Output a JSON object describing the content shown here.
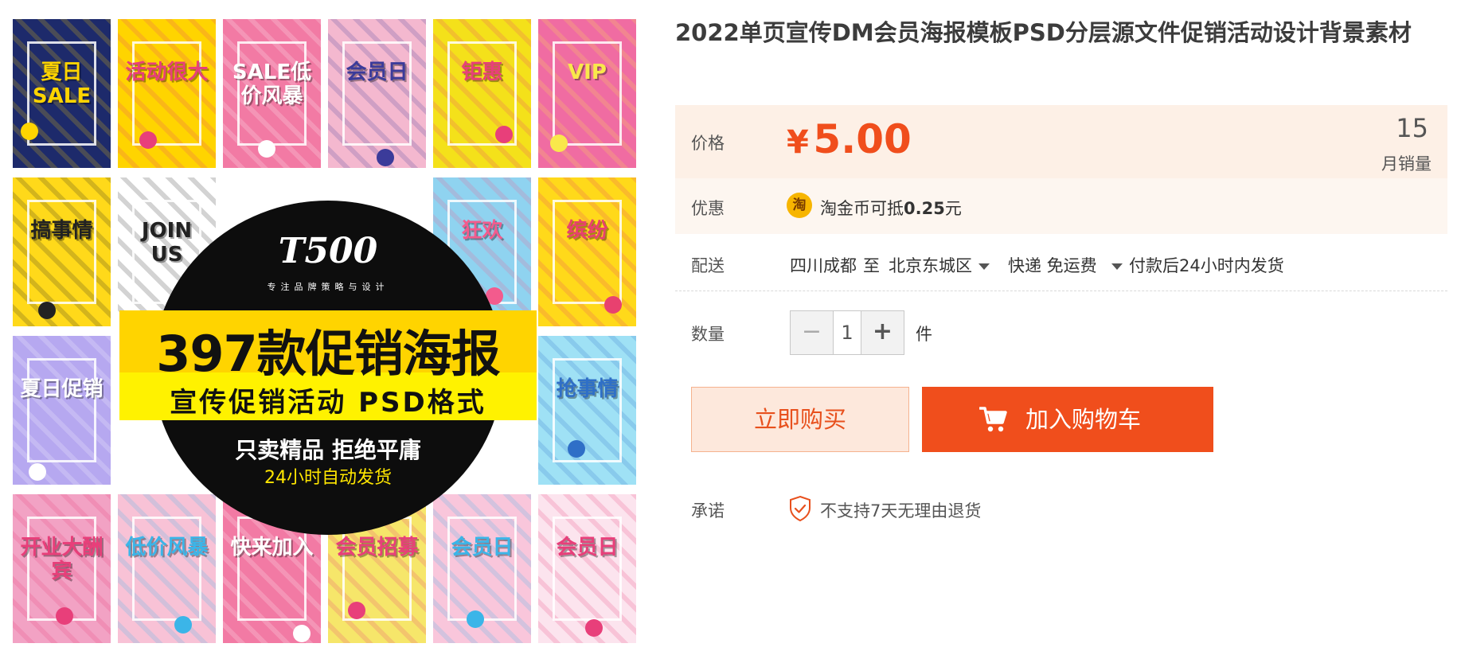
{
  "product": {
    "title": "2022单页宣传DM会员海报模板PSD分层源文件促销活动设计背景素材",
    "image": {
      "logo": "T500",
      "tagline": "专注品牌策略与设计",
      "headline": "397款促销海报",
      "subheadline": "宣传促销活动 PSD格式",
      "line1": "只卖精品 拒绝平庸",
      "line2": "24小时自动发货",
      "thumbnails": [
        {
          "text": "夏日SALE",
          "bg": "#1d2a6b",
          "accent": "#ffd400"
        },
        {
          "text": "活动很大",
          "bg": "#ffd400",
          "accent": "#e83f7a"
        },
        {
          "text": "SALE低价风暴",
          "bg": "#f27aa4",
          "accent": "#ffffff"
        },
        {
          "text": "会员日",
          "bg": "#f4b8cf",
          "accent": "#3b3b9a"
        },
        {
          "text": "钜惠",
          "bg": "#f4e11a",
          "accent": "#e83f7a"
        },
        {
          "text": "VIP",
          "bg": "#f06ca2",
          "accent": "#f9e84b"
        },
        {
          "text": "搞事情",
          "bg": "#ffd91a",
          "accent": "#222222"
        },
        {
          "text": "JOIN US",
          "bg": "#ffffff",
          "accent": "#222222"
        },
        {
          "text": "狂欢",
          "bg": "#8fd3f0",
          "accent": "#f35b8d"
        },
        {
          "text": "缤纷",
          "bg": "#ffd91a",
          "accent": "#e8416f"
        },
        {
          "text": "夏日促销",
          "bg": "#b6a8f0",
          "accent": "#ffffff"
        },
        {
          "text": "抢事情",
          "bg": "#9fe1f5",
          "accent": "#2f6fc7"
        },
        {
          "text": "开业大酬宾",
          "bg": "#f2a2c4",
          "accent": "#e83f7a"
        },
        {
          "text": "低价风暴",
          "bg": "#f8c2d6",
          "accent": "#3bb5e8"
        },
        {
          "text": "快来加入",
          "bg": "#f27aa4",
          "accent": "#ffffff"
        },
        {
          "text": "会员招募",
          "bg": "#f6e66a",
          "accent": "#e83f7a"
        },
        {
          "text": "会员日",
          "bg": "#f9c6db",
          "accent": "#3bb5e8"
        },
        {
          "text": "会员日",
          "bg": "#fce4ee",
          "accent": "#e83f7a"
        }
      ]
    }
  },
  "price": {
    "label": "价格",
    "currency": "¥",
    "amount": "5.00",
    "sales_count": "15",
    "sales_label": "月销量"
  },
  "promo": {
    "label": "优惠",
    "coin_icon": "淘",
    "text": "淘金币可抵",
    "amount": "0.25",
    "unit": "元"
  },
  "shipping": {
    "label": "配送",
    "from": "四川成都",
    "to_word": "至",
    "to": "北京东城区",
    "method": "快递 免运费",
    "dispatch": "付款后24小时内发货"
  },
  "quantity": {
    "label": "数量",
    "minus": "−",
    "plus": "+",
    "value": "1",
    "unit": "件"
  },
  "actions": {
    "buy_now": "立即购买",
    "add_to_cart": "加入购物车"
  },
  "promise": {
    "label": "承诺",
    "text": "不支持7天无理由退货"
  },
  "colors": {
    "accent": "#f04e1c",
    "price_bg": "#fdf0e6",
    "buy_bg": "#fde8dc"
  }
}
